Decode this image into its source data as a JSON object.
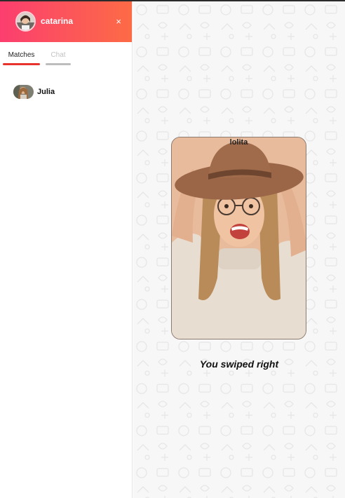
{
  "colors": {
    "header_gradient_start": "#fb3e6f",
    "header_gradient_end": "#fd6b46",
    "tab_active": "#e8322d",
    "tab_inactive": "#bdbdbd"
  },
  "sidebar": {
    "user": {
      "name": "catarina",
      "avatar_icon": "user-avatar"
    },
    "close_icon": "×",
    "tabs": [
      {
        "label": "Matches",
        "active": true
      },
      {
        "label": "Chat",
        "active": false
      }
    ],
    "matches": [
      {
        "name": "Julia",
        "avatar_icon": "match-avatar"
      }
    ]
  },
  "main": {
    "card": {
      "name": "lolita",
      "photo_icon": "profile-photo"
    },
    "message": "You swiped right"
  }
}
